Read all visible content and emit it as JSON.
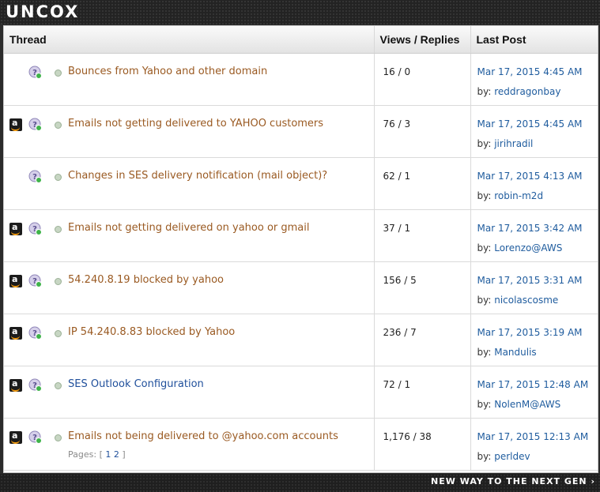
{
  "brand": {
    "logo_text": "UNCOX",
    "slogan": "NEW WAY TO THE NEXT GEN ›"
  },
  "table": {
    "headers": {
      "thread": "Thread",
      "views": "Views / Replies",
      "last_post": "Last Post"
    },
    "rows": [
      {
        "amazon": false,
        "title": "Bounces from Yahoo and other domain",
        "title_color": "#9a5a22",
        "views": "16 / 0",
        "date": "Mar 17, 2015 4:45 AM",
        "by": "by:",
        "user": "reddragonbay"
      },
      {
        "amazon": true,
        "title": "Emails not getting delivered to YAHOO customers",
        "title_color": "#9a5a22",
        "views": "76 / 3",
        "date": "Mar 17, 2015 4:45 AM",
        "by": "by:",
        "user": "jirihradil"
      },
      {
        "amazon": false,
        "title": "Changes in SES delivery notification (mail object)?",
        "title_color": "#9a5a22",
        "views": "62 / 1",
        "date": "Mar 17, 2015 4:13 AM",
        "by": "by:",
        "user": "robin-m2d"
      },
      {
        "amazon": true,
        "title": "Emails not getting delivered on yahoo or gmail",
        "title_color": "#9a5a22",
        "views": "37 / 1",
        "date": "Mar 17, 2015 3:42 AM",
        "by": "by:",
        "user": "Lorenzo@AWS"
      },
      {
        "amazon": true,
        "title": "54.240.8.19 blocked by yahoo",
        "title_color": "#9a5a22",
        "views": "156 / 5",
        "date": "Mar 17, 2015 3:31 AM",
        "by": "by:",
        "user": "nicolascosme"
      },
      {
        "amazon": true,
        "title": "IP 54.240.8.83 blocked by Yahoo",
        "title_color": "#9a5a22",
        "views": "236 / 7",
        "date": "Mar 17, 2015 3:19 AM",
        "by": "by:",
        "user": "Mandulis"
      },
      {
        "amazon": true,
        "title": "SES Outlook Configuration",
        "title_color": "#1f4f9b",
        "views": "72 / 1",
        "date": "Mar 17, 2015 12:48 AM",
        "by": "by:",
        "user": "NolenM@AWS"
      },
      {
        "amazon": true,
        "title": "Emails not being delivered to @yahoo.com accounts",
        "title_color": "#9a5a22",
        "views": "1,176 / 38",
        "date": "Mar 17, 2015 12:13 AM",
        "by": "by:",
        "user": "perldev",
        "pages": {
          "label": "Pages:",
          "open": "[",
          "items": [
            "1",
            "2"
          ],
          "close": "]"
        }
      }
    ]
  }
}
